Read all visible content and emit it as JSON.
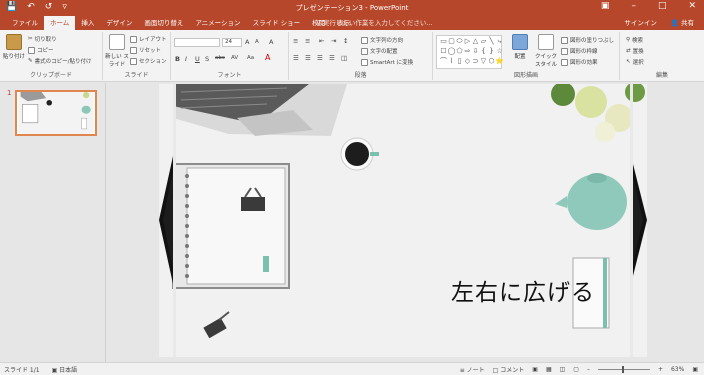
{
  "titlebar": {
    "title": "プレゼンテーション3 - PowerPoint",
    "save_icon": "save-icon",
    "undo_icon": "undo-icon",
    "redo_icon": "redo-icon",
    "customize_icon": "customize-qat-icon",
    "minimize": "–",
    "maximize": "□",
    "close": "✕"
  },
  "tabs": [
    "ファイル",
    "ホーム",
    "挿入",
    "デザイン",
    "画面切り替え",
    "アニメーション",
    "スライド ショー",
    "校閲",
    "表示"
  ],
  "active_tab": "ホーム",
  "tellme": "♀ 実行したい作業を入力してください...",
  "signin": "サインイン",
  "share": "共有",
  "ribbon": {
    "clipboard": {
      "label": "クリップボード",
      "paste": "貼り付け",
      "cut": "切り取り",
      "copy": "コピー",
      "format_painter": "書式のコピー/貼り付け"
    },
    "slides": {
      "label": "スライド",
      "new_slide": "新しい スライド",
      "layout": "レイアウト",
      "reset": "リセット",
      "section": "セクション"
    },
    "font": {
      "label": "フォント",
      "font_name": "",
      "font_size": "24",
      "bold": "B",
      "italic": "I",
      "underline": "U",
      "shadow": "S",
      "strike": "abc",
      "spacing": "AV",
      "case": "Aa",
      "grow": "A",
      "shrink": "A",
      "clear": "A"
    },
    "paragraph": {
      "label": "段落",
      "text_direction": "文字列の方向",
      "align_text": "文字の配置",
      "smartart": "SmartArt に変換"
    },
    "drawing": {
      "label": "図形描画",
      "arrange": "配置",
      "quick_styles": "クイック スタイル",
      "fill": "図形の塗りつぶし",
      "outline": "図形の枠線",
      "effects": "図形の効果"
    },
    "editing": {
      "label": "編集",
      "find": "検索",
      "replace": "置換",
      "select": "選択"
    }
  },
  "thumbnail": {
    "number": "1"
  },
  "slide": {
    "text": "左右に広げる"
  },
  "status": {
    "slide_count": "スライド 1/1",
    "language": "日本語",
    "notes": "ノート",
    "comments": "コメント",
    "zoom": "63%"
  }
}
